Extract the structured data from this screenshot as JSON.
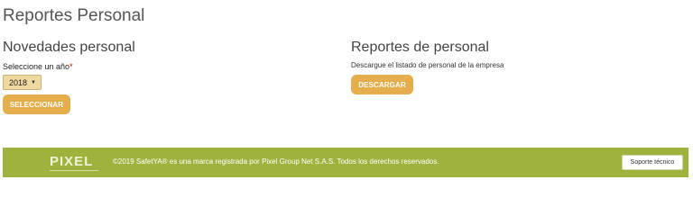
{
  "page": {
    "title": "Reportes Personal"
  },
  "novedades": {
    "title": "Novedades personal",
    "year_label": "Seleccione un año",
    "required_mark": "*",
    "year_value": "2018",
    "select_button": "SELECCIONAR"
  },
  "reportes": {
    "title": "Reportes de personal",
    "description": "Descargue el listado de personal de la empresa",
    "download_button": "DESCARGAR"
  },
  "footer": {
    "logo_text": "PIXEL",
    "copyright": "©2019 SafetYA® es una marca registrada por Pixel Group Net S.A.S. Todos los derechos reservados.",
    "support_button": "Soporte técnico"
  },
  "colors": {
    "accent": "#e5ad4b",
    "footer_bg": "#9fb23d",
    "select_bg": "#efd9a0"
  },
  "icons": {
    "select_caret": "caret-down-icon"
  }
}
